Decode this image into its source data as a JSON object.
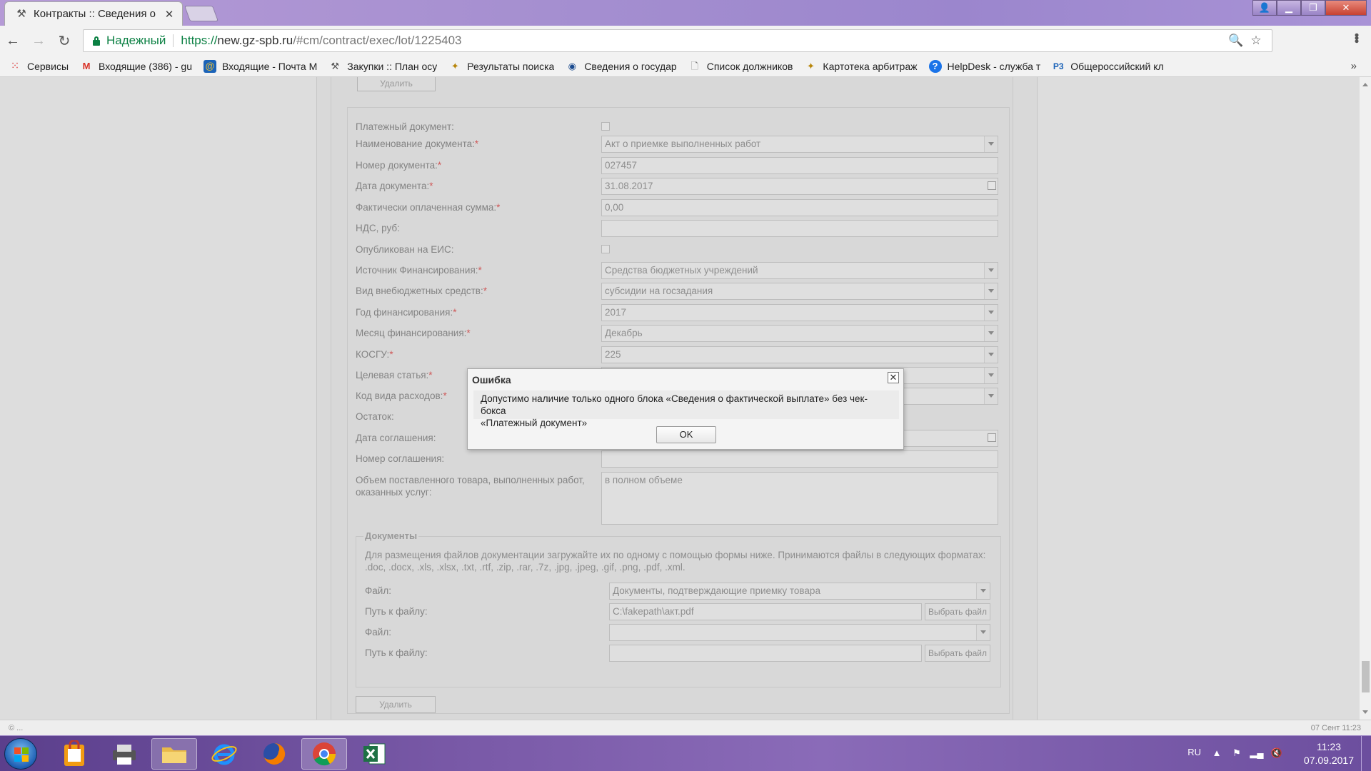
{
  "browser": {
    "tab_title": "Контракты :: Сведения о",
    "secure_label": "Надежный",
    "url_scheme": "https://",
    "url_host": "new.gz-spb.ru",
    "url_path": "/#cm/contract/exec/lot/1225403"
  },
  "bookmarks": [
    {
      "label": "Сервисы",
      "icon": "apps-grid-icon"
    },
    {
      "label": "Входящие (386) - gu",
      "icon": "gmail-icon"
    },
    {
      "label": "Входящие - Почта M",
      "icon": "mail-icon"
    },
    {
      "label": "Закупки :: План осу",
      "icon": "hammer-icon"
    },
    {
      "label": "Результаты поиска",
      "icon": "emblem-icon"
    },
    {
      "label": "Сведения о государ",
      "icon": "seal-icon"
    },
    {
      "label": "Список должников",
      "icon": "page-icon"
    },
    {
      "label": "Картотека арбитраж",
      "icon": "emblem-icon"
    },
    {
      "label": "HelpDesk - служба т",
      "icon": "help-icon"
    },
    {
      "label": "Общероссийский кл",
      "icon": "p3-icon"
    }
  ],
  "form": {
    "top_delete_label": "Удалить",
    "bottom_delete_label": "Удалить",
    "fields": [
      {
        "label": "Платежный документ:",
        "required": false,
        "type": "checkbox",
        "value": ""
      },
      {
        "label": "Наименование документа:",
        "required": true,
        "type": "select",
        "value": "Акт о приемке выполненных работ"
      },
      {
        "label": "Номер документа:",
        "required": true,
        "type": "text",
        "value": "027457"
      },
      {
        "label": "Дата документа:",
        "required": true,
        "type": "date",
        "value": "31.08.2017"
      },
      {
        "label": "Фактически оплаченная сумма:",
        "required": true,
        "type": "text",
        "value": "0,00"
      },
      {
        "label": "НДС, руб:",
        "required": false,
        "type": "text",
        "value": ""
      },
      {
        "label": "Опубликован на ЕИС:",
        "required": false,
        "type": "checkbox",
        "value": ""
      },
      {
        "label": "Источник Финансирования:",
        "required": true,
        "type": "select",
        "value": "Средства бюджетных учреждений"
      },
      {
        "label": "Вид внебюджетных средств:",
        "required": true,
        "type": "select",
        "value": "субсидии на госзадания"
      },
      {
        "label": "Год финансирования:",
        "required": true,
        "type": "select",
        "value": "2017"
      },
      {
        "label": "Месяц финансирования:",
        "required": true,
        "type": "select",
        "value": "Декабрь"
      },
      {
        "label": "КОСГУ:",
        "required": true,
        "type": "select",
        "value": "225"
      },
      {
        "label": "Целевая статья:",
        "required": true,
        "type": "select",
        "value": ""
      },
      {
        "label": "Код вида расходов:",
        "required": true,
        "type": "select",
        "value": ""
      },
      {
        "label": "Остаток:",
        "required": false,
        "type": "none",
        "value": ""
      },
      {
        "label": "Дата соглашения:",
        "required": false,
        "type": "date",
        "value": ""
      },
      {
        "label": "Номер соглашения:",
        "required": false,
        "type": "text",
        "value": ""
      }
    ],
    "volume_label_1": "Объем поставленного товара, выполненных работ,",
    "volume_label_2": "оказанных услуг:",
    "volume_value": "в полном объеме"
  },
  "documents": {
    "legend": "Документы",
    "hint_1": "Для размещения файлов документации загружайте их по одному с помощью формы ниже. Принимаются файлы в следующих форматах:",
    "hint_2": ".doc, .docx, .xls, .xlsx, .txt, .rtf, .zip, .rar, .7z, .jpg, .jpeg, .gif, .png, .pdf, .xml.",
    "file_label": "Файл:",
    "path_label": "Путь к файлу:",
    "choose_label": "Выбрать файл",
    "file_1_value": "Документы, подтверждающие приемку товара",
    "path_1_value": "C:\\fakepath\\акт.pdf",
    "file_2_value": "",
    "path_2_value": ""
  },
  "dialog": {
    "title": "Ошибка",
    "message_1": "Допустимо наличие только одного блока «Сведения о фактической выплате» без чек-бокса",
    "message_2": "«Платежный документ»",
    "ok_label": "OK"
  },
  "statusbar": {
    "left": "© ...",
    "right": "07 Сент 11:23"
  },
  "taskbar": {
    "lang": "RU",
    "time": "11:23",
    "date": "07.09.2017"
  }
}
